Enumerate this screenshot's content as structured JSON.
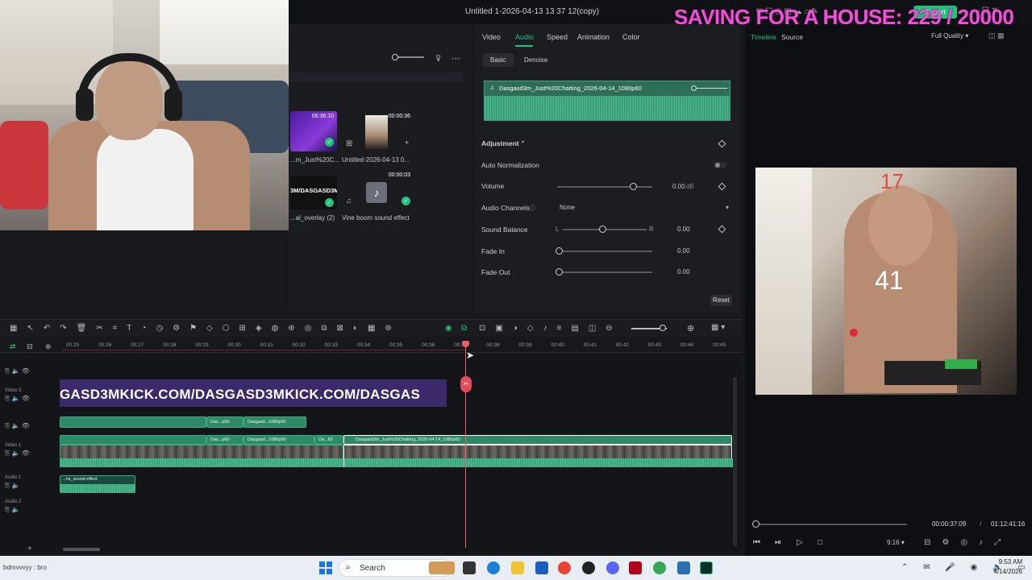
{
  "window": {
    "title": "Untitled 1-2026-04-13 13 37 12(copy)",
    "overlay_banner": "SAVING FOR A HOUSE: 229 / 20000",
    "export_label": "Export"
  },
  "media": {
    "items": [
      {
        "label": "...m_Just%20C...",
        "duration": "06:36:10"
      },
      {
        "label": "Untitled-2026-04-13 0...",
        "duration": "00:00:36"
      },
      {
        "label": "...al_overlay (2)",
        "overlay_text": "3M/DASGASD3M"
      },
      {
        "label": "Vine boom sound effect",
        "duration": "00:00:03"
      }
    ]
  },
  "properties": {
    "tabs": [
      "Video",
      "Audio",
      "Speed",
      "Animation",
      "Color"
    ],
    "active_tab": "Audio",
    "subtabs": [
      "Basic",
      "Denoise"
    ],
    "active_subtab": "Basic",
    "clip_name": "Dasgasd3m_Just%20Chatting_2026-04-14_1080p60",
    "adjustment_label": "Adjustment",
    "auto_normalization_label": "Auto Normalization",
    "volume": {
      "label": "Volume",
      "value": "0.00",
      "unit": "dB"
    },
    "audio_channels": {
      "label": "Audio Channels",
      "value": "None"
    },
    "sound_balance": {
      "label": "Sound Balance",
      "left": "L",
      "right": "R",
      "value": "0.00"
    },
    "fade_in": {
      "label": "Fade In",
      "value": "0.00"
    },
    "fade_out": {
      "label": "Fade Out",
      "value": "0.00"
    },
    "reset_label": "Reset"
  },
  "preview": {
    "tabs": [
      "Timeline",
      "Source"
    ],
    "active_tab": "Timeline",
    "quality": "Full Quality",
    "overlay_number_top": "17",
    "overlay_number_mid": "41",
    "current_time": "00:00:37:09",
    "separator": "/",
    "total_time": "01:12:41:16",
    "aspect": "9:16"
  },
  "timeline": {
    "ruler": [
      "00:25",
      "00:26",
      "00:27",
      "00:28",
      "00:29",
      "00:30",
      "00:31",
      "00:32",
      "00:33",
      "00:34",
      "00:35",
      "00:36",
      "00:37",
      "00:38",
      "00:39",
      "00:40",
      "00:41",
      "00:42",
      "00:43",
      "00:44",
      "00:45"
    ],
    "tracks": {
      "video3": "Video 3",
      "video1": "Video 1",
      "audio1": "Audio 1",
      "audio2": "Audio 2"
    },
    "scroll_text_clip": "GASD3MKICK.COM/DASGASD3MKICK.COM/DASGAS",
    "clips_top": [
      "Das...p60",
      "Dasgasd...1080p60"
    ],
    "clips_main": [
      "Das...p60",
      "Dasgasd...1080p60",
      "Da...60",
      "Dasgasd3m_Just%20Chatting_2026-04-14_1080p60"
    ],
    "audio_clip": "...ne_sound effect"
  },
  "taskbar": {
    "search_placeholder": "Search",
    "time": "9:53 AM",
    "date": "4/14/2026",
    "left_text": "bdmvvvyy : bro"
  }
}
